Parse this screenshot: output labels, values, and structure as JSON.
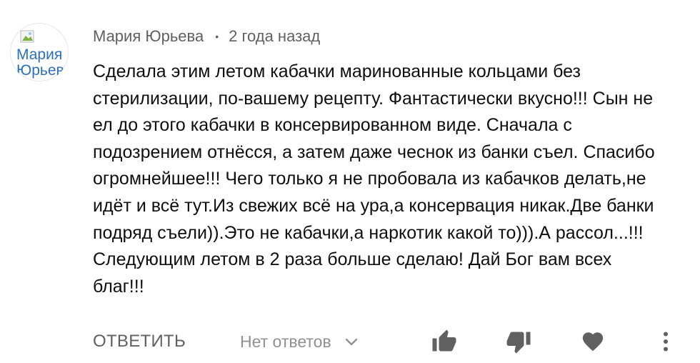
{
  "comment": {
    "author": "Мария Юрьева",
    "separator": "•",
    "timestamp": "2 года назад",
    "avatar_alt": "Мария\nЮрьева",
    "text_lines": [
      "Сделала этим летом кабачки маринованные кольцами без",
      "стерилизации, по-вашему рецепту. Фантастически вкусно!!! Сын не",
      "ел до этого кабачки в консервированном виде. Сначала с",
      "подозрением отнёсся, а затем даже чеснок из банки съел. Спасибо",
      "огромнейшее!!!  Чего только я не пробовала из кабачков делать,не",
      "идёт и всё тут.Из свежих всё на ура,а консервация никак.Две банки",
      "подряд съели)).Это не кабачки,а наркотик какой то))).А рассол...!!!",
      "Следующим летом в 2 раза больше сделаю! Дай Бог вам всех",
      "благ!!!"
    ]
  },
  "actions": {
    "reply_label": "ОТВЕТИТЬ",
    "replies_label": "Нет ответов",
    "icons": {
      "replies_toggle": "chevron-down-icon",
      "like": "thumbs-up-icon",
      "dislike": "thumbs-down-icon",
      "heart": "heart-icon",
      "more": "more-vertical-icon"
    }
  },
  "colors": {
    "meta_text": "#606060",
    "body_text": "#0f0f0f",
    "icon": "#606060",
    "muted": "#909090",
    "avatar_text": "#2b6fbf"
  }
}
